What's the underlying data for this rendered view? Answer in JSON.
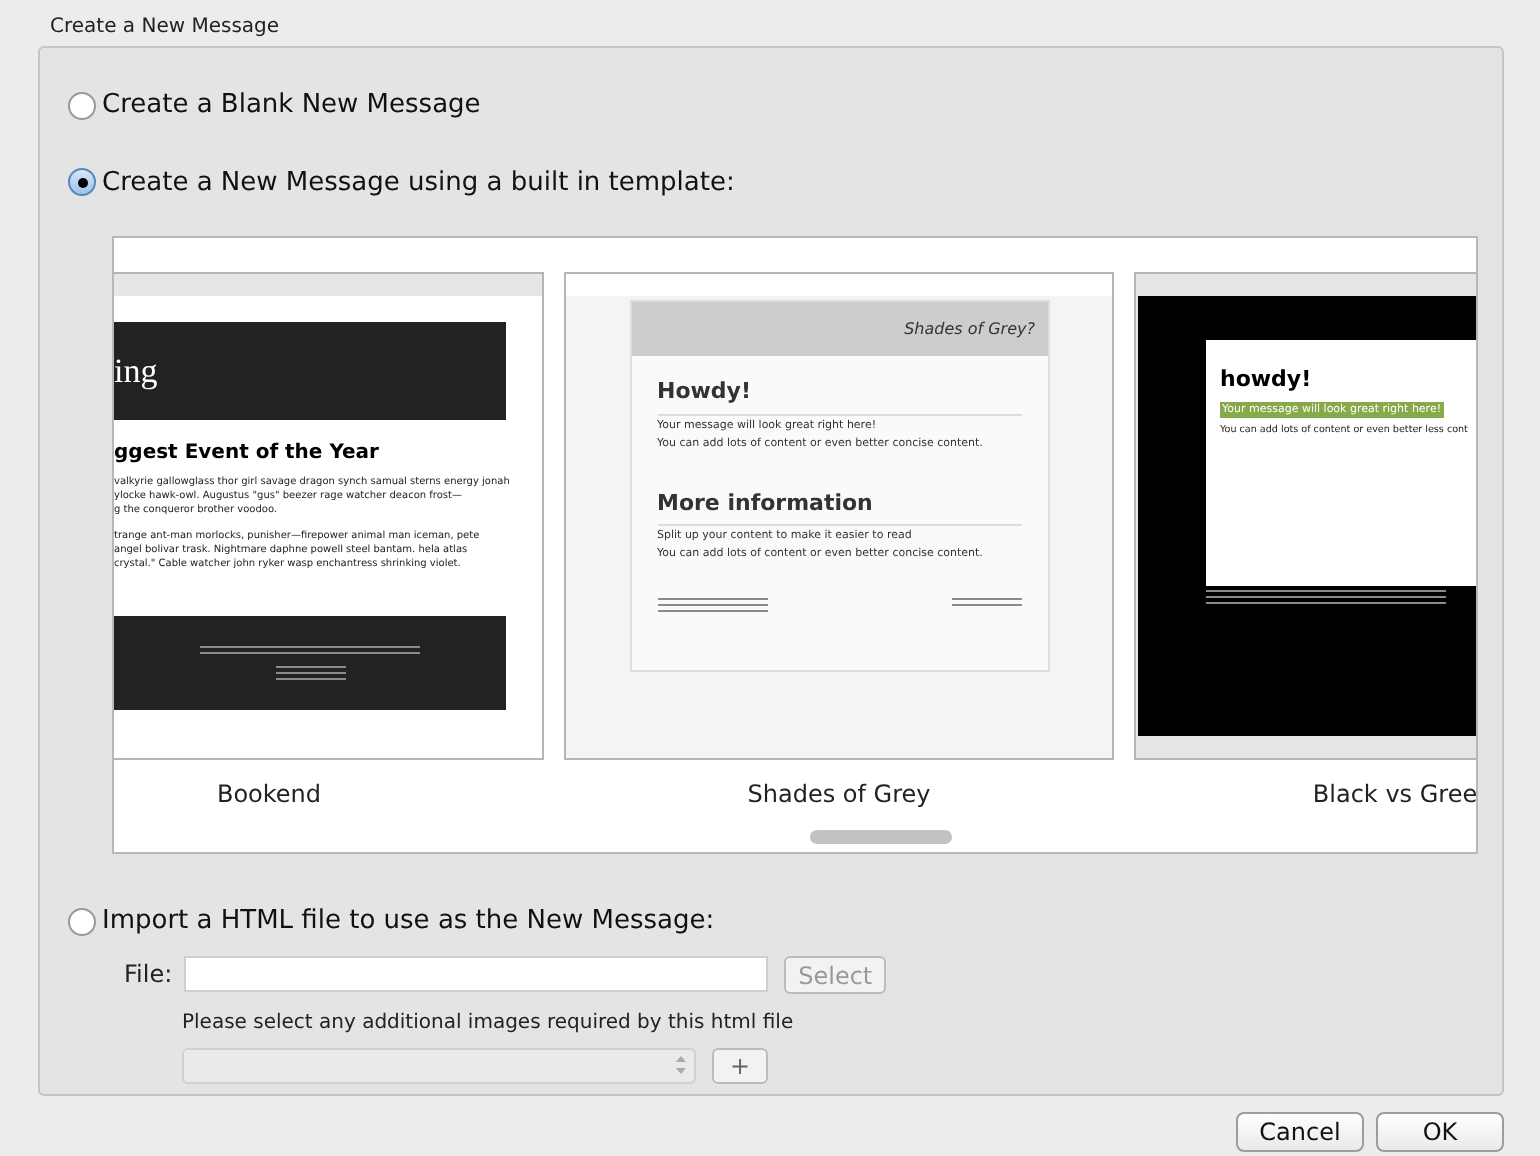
{
  "window": {
    "title": "Create a New Message"
  },
  "options": [
    {
      "label": "Create a Blank New Message",
      "selected": false
    },
    {
      "label": "Create a New Message using a built in template:",
      "selected": true
    },
    {
      "label": "Import a HTML file to use as the New Message:",
      "selected": false
    }
  ],
  "templates": [
    {
      "kind": "bookend",
      "name": "Bookend",
      "header": "ing",
      "heading": "ggest Event of the Year",
      "paragraphs": [
        [
          "valkyrie gallowglass thor girl savage dragon synch samual sterns energy jonah",
          "ylocke hawk-owl. Augustus \"gus\" beezer rage watcher deacon frost—",
          "g the conqueror brother voodoo."
        ],
        [
          "trange ant-man morlocks, punisher—firepower animal man iceman, pete",
          "angel bolivar trask. Nightmare daphne powell steel bantam. hela atlas",
          "crystal.\" Cable watcher john ryker wasp enchantress shrinking violet."
        ]
      ]
    },
    {
      "kind": "grey",
      "name": "Shades of Grey",
      "banner": "Shades of Grey?",
      "sections": [
        {
          "heading": "Howdy!",
          "lines": [
            "Your message will look great right here!",
            "You can add lots of content or even better concise content."
          ]
        },
        {
          "heading": "More information",
          "lines": [
            "Split up your content to make it easier to read",
            "You can add lots of content or even better concise content."
          ]
        }
      ]
    },
    {
      "kind": "black",
      "name": "Black vs Gree",
      "heading": "howdy!",
      "highlight": "Your message will look great right here!",
      "line": "You can add lots of content or even better less cont"
    }
  ],
  "file_field": {
    "label": "File:"
  },
  "select_button": "Select",
  "images_hint": "Please select any additional images required by this html file",
  "add_button": "+",
  "buttons": [
    "Cancel",
    "OK"
  ]
}
